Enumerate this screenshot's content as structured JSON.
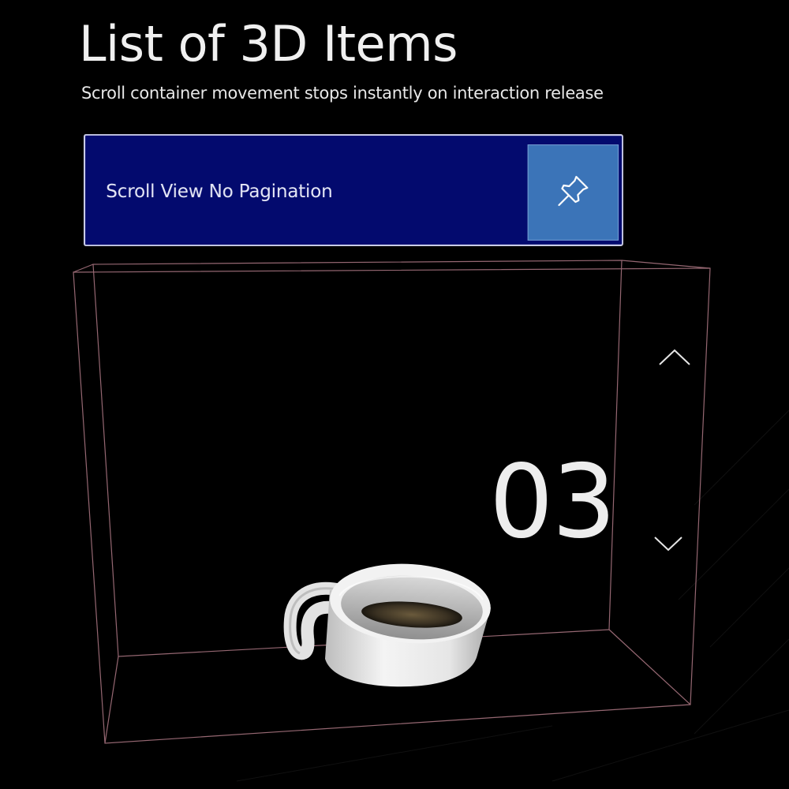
{
  "header": {
    "title": "List of 3D Items",
    "subtitle": "Scroll container movement stops instantly on interaction release"
  },
  "titlebar": {
    "label": "Scroll View No Pagination",
    "pin_icon": "pin-icon",
    "colors": {
      "background": "#030a6e",
      "pin_button": "#3b74b8"
    }
  },
  "scroll_view": {
    "current_item": "03",
    "item_model": "coffee-cup",
    "scroll_up_icon": "chevron-up-icon",
    "scroll_down_icon": "chevron-down-icon",
    "frame_color": "#b07a86"
  }
}
